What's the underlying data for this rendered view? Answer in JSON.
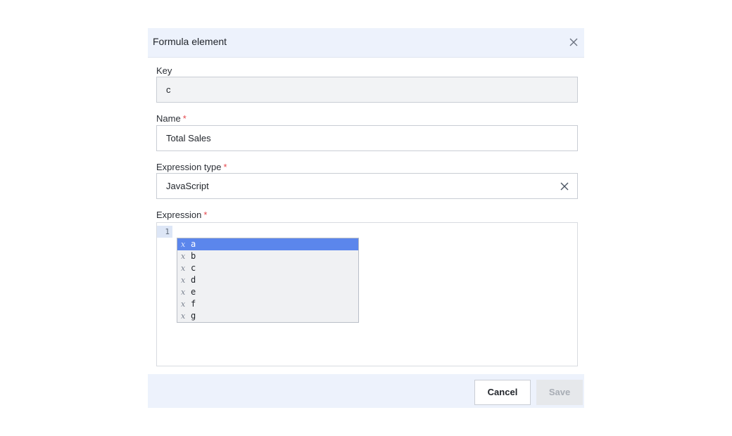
{
  "dialog": {
    "title": "Formula element"
  },
  "fields": {
    "key": {
      "label": "Key",
      "value": "c"
    },
    "name": {
      "label": "Name",
      "required_mark": "*",
      "value": "Total Sales"
    },
    "expression_type": {
      "label": "Expression type",
      "required_mark": "*",
      "value": "JavaScript"
    },
    "expression": {
      "label": "Expression",
      "required_mark": "*",
      "line_number": "1"
    }
  },
  "autocomplete": {
    "type_glyph": "x",
    "items": [
      {
        "label": "a",
        "selected": true
      },
      {
        "label": "b"
      },
      {
        "label": "c"
      },
      {
        "label": "d"
      },
      {
        "label": "e"
      },
      {
        "label": "f"
      },
      {
        "label": "g"
      }
    ]
  },
  "footer": {
    "cancel_label": "Cancel",
    "save_label": "Save"
  },
  "icons": {
    "close": "close-icon",
    "clear": "clear-icon"
  },
  "colors": {
    "header_bg": "#edf2fc",
    "selected_item": "#5b86ec",
    "required": "#e5484d"
  }
}
